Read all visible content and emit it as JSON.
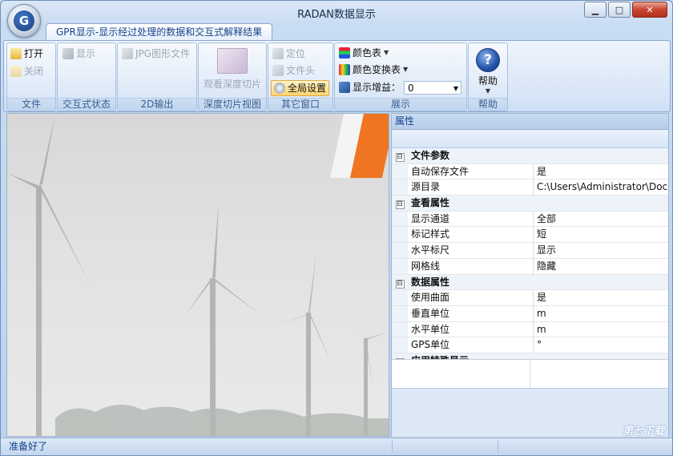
{
  "window": {
    "title": "RADAN数据显示",
    "app_logo_letter": "G",
    "minimize_glyph": "▁",
    "maximize_glyph": "□",
    "close_glyph": "✕"
  },
  "ribbon": {
    "tab": "GPR显示-显示经过处理的数据和交互式解释结果",
    "groups": {
      "file": {
        "label": "文件",
        "open": "打开",
        "close": "关闭"
      },
      "interactive": {
        "label": "交互式状态",
        "display": "显示"
      },
      "output2d": {
        "label": "2D输出",
        "jpg": "JPG图形文件"
      },
      "depth": {
        "label": "深度切片视图",
        "view_slice": "观看深度切片"
      },
      "other": {
        "label": "其它窗口",
        "locate": "定位",
        "file_header": "文件头",
        "global_settings": "全局设置"
      },
      "show": {
        "label": "展示",
        "color_table": "颜色表",
        "color_transform": "颜色变换表",
        "gain_label": "显示增益：",
        "gain_value": "0"
      },
      "help": {
        "label": "帮助",
        "help": "帮助",
        "help_glyph": "?"
      }
    }
  },
  "properties": {
    "title": "属性",
    "categories": [
      {
        "name": "文件参数",
        "toggle": "⊟",
        "rows": [
          {
            "name": "自动保存文件",
            "value": "是"
          },
          {
            "name": "源目录",
            "value": "C:\\Users\\Administrator\\Docu..."
          }
        ]
      },
      {
        "name": "查看属性",
        "toggle": "⊟",
        "rows": [
          {
            "name": "显示通道",
            "value": "全部"
          },
          {
            "name": "标记样式",
            "value": "短"
          },
          {
            "name": "水平标尺",
            "value": "显示"
          },
          {
            "name": "网格线",
            "value": "隐藏"
          }
        ]
      },
      {
        "name": "数据属性",
        "toggle": "⊟",
        "rows": [
          {
            "name": "使用曲面",
            "value": "是"
          },
          {
            "name": "垂直单位",
            "value": "m"
          },
          {
            "name": "水平单位",
            "value": "m"
          },
          {
            "name": "GPS单位",
            "value": "°"
          }
        ]
      },
      {
        "name": "应用特殊显示",
        "toggle": "⊞",
        "rows": []
      }
    ]
  },
  "status": {
    "text": "准备好了"
  },
  "watermark": "第七下载"
}
